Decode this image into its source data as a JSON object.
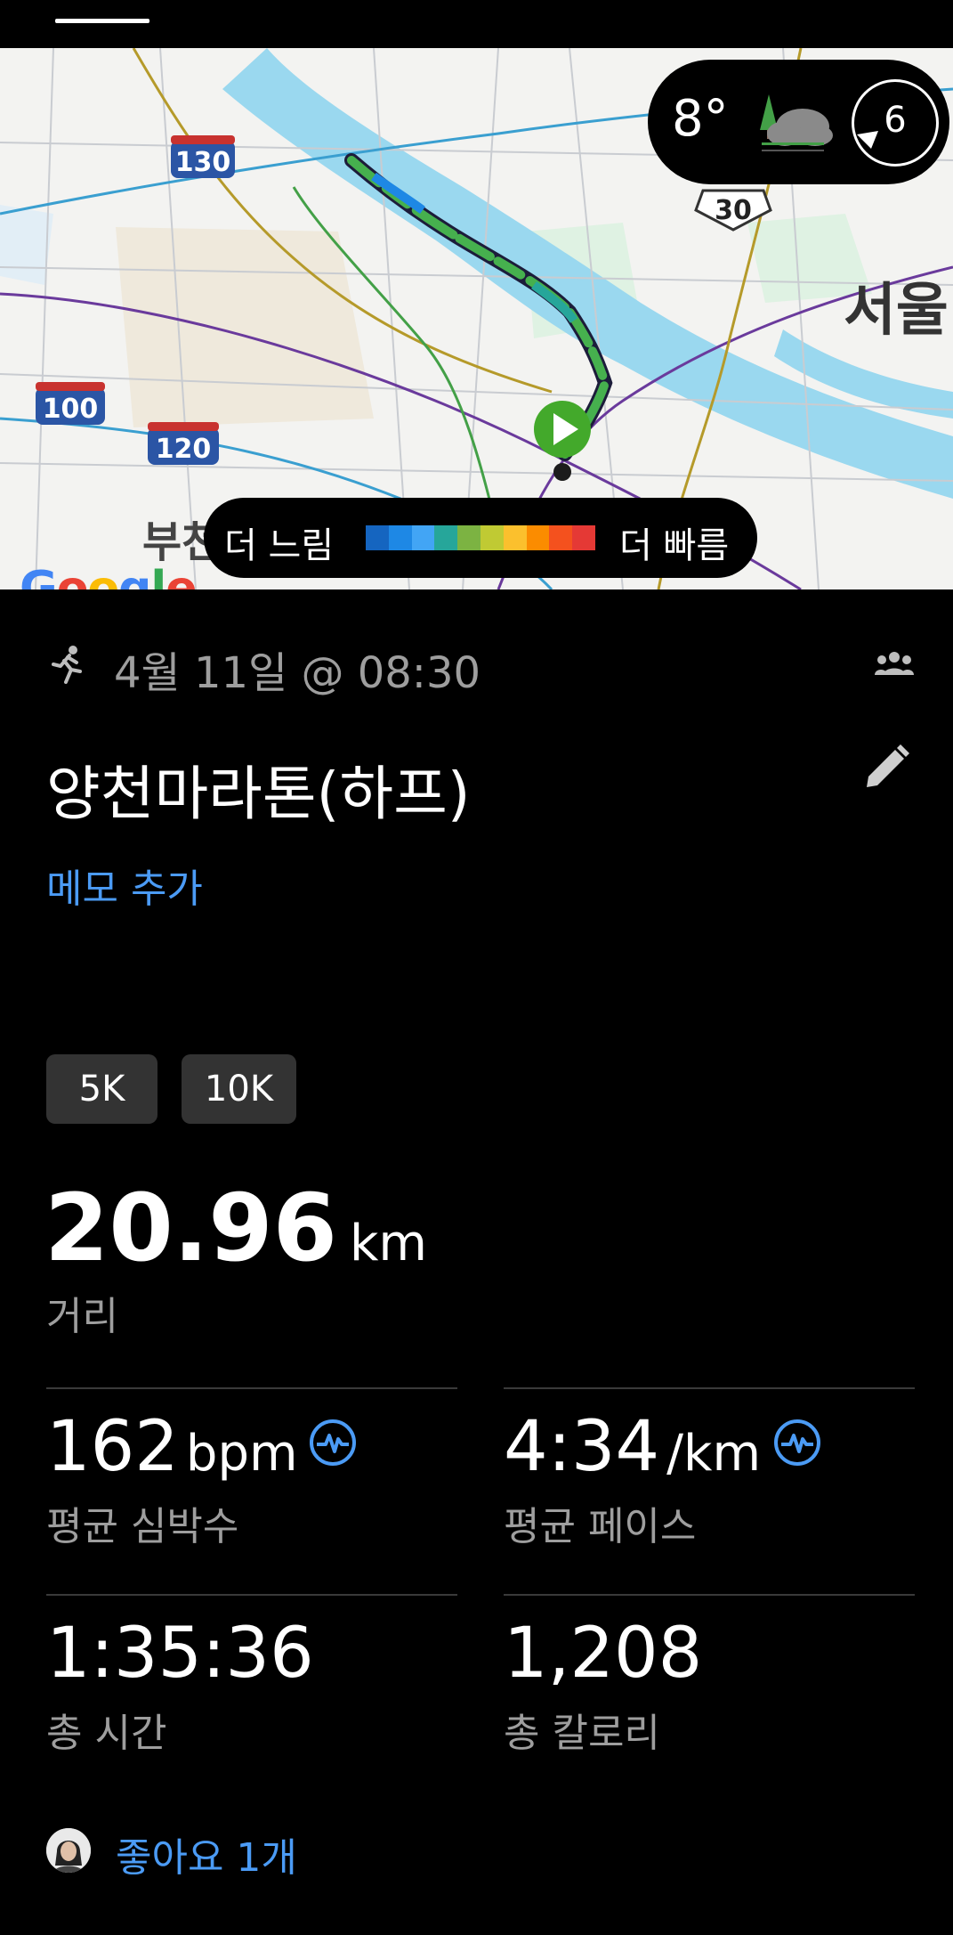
{
  "status_bar": {},
  "map": {
    "road_labels": [
      "130",
      "100",
      "120",
      "30"
    ],
    "city_label": "서울",
    "partial_label": "부천",
    "google_logo": "Google"
  },
  "weather": {
    "temperature": "8°",
    "icon": "cloud-tree-icon",
    "wind": "6"
  },
  "speed_legend": {
    "slow_label": "더 느림",
    "fast_label": "더 빠름",
    "colors": [
      "#1565c0",
      "#1e88e5",
      "#42a5f5",
      "#26a69a",
      "#7cb342",
      "#c0ca33",
      "#fbc02d",
      "#fb8c00",
      "#f4511e",
      "#e53935"
    ]
  },
  "activity": {
    "icon": "runner-icon",
    "date": "4월 11일 @ 08:30",
    "title": "양천마라톤(하프)",
    "memo_link": "메모 추가",
    "chips": [
      "5K",
      "10K"
    ]
  },
  "distance": {
    "value": "20.96",
    "unit": "km",
    "label": "거리"
  },
  "stats": {
    "heart_rate": {
      "value": "162",
      "unit": "bpm",
      "label": "평균 심박수"
    },
    "pace": {
      "value": "4:34",
      "unit": "/km",
      "label": "평균 페이스"
    },
    "time": {
      "value": "1:35:36",
      "label": "총 시간"
    },
    "calories": {
      "value": "1,208",
      "label": "총 칼로리"
    }
  },
  "likes": {
    "text": "좋아요 1개"
  },
  "colors": {
    "accent": "#4b9bf5",
    "muted": "#9e9e9e",
    "start_marker": "#43a92b",
    "chip_bg": "#333333"
  }
}
